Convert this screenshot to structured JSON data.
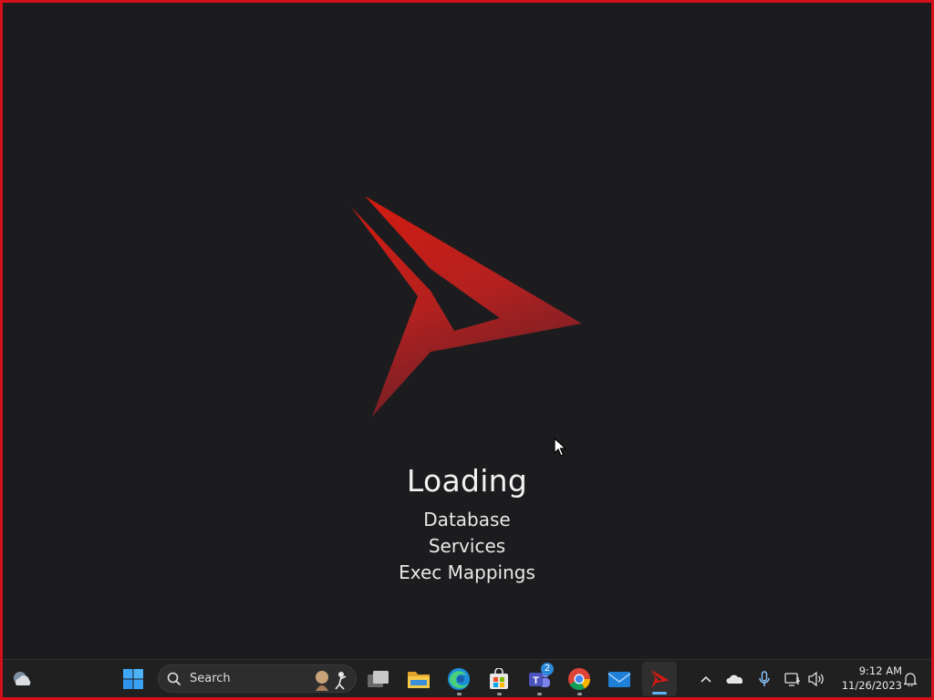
{
  "splash": {
    "loading_title": "Loading",
    "steps": [
      "Database",
      "Services",
      "Exec Mappings"
    ],
    "logo": "red-arrow-logo",
    "brand_color": "#d6101a",
    "background_color": "#1c1c1f"
  },
  "taskbar": {
    "weather": "weather-icon",
    "start": "windows-start-icon",
    "search": {
      "placeholder": "Search"
    },
    "apps": [
      {
        "name": "task-view",
        "running": false
      },
      {
        "name": "file-explorer",
        "running": false
      },
      {
        "name": "edge",
        "running": true
      },
      {
        "name": "microsoft-store",
        "running": true
      },
      {
        "name": "teams",
        "running": true,
        "badge": "2"
      },
      {
        "name": "chrome",
        "running": true
      },
      {
        "name": "mail",
        "running": false
      },
      {
        "name": "red-arrow-app",
        "running": true,
        "active": true
      }
    ],
    "tray": [
      "chevron-up",
      "onedrive",
      "microphone",
      "network",
      "volume"
    ],
    "clock": {
      "time": "9:12 AM",
      "date": "11/26/2023"
    },
    "notification": "notification-bell-icon"
  }
}
